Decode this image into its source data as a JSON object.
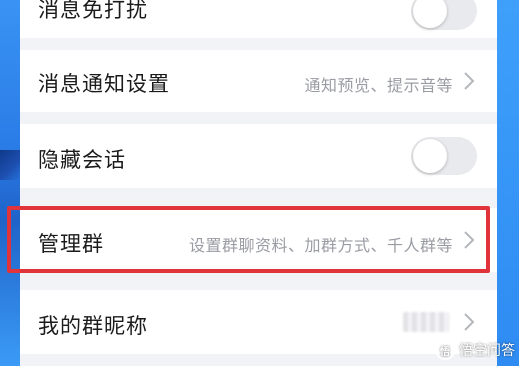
{
  "settings": {
    "rows": [
      {
        "label": "消息免打扰",
        "type": "toggle",
        "value": "",
        "enabled": false
      },
      {
        "label": "消息通知设置",
        "type": "link",
        "value": "通知预览、提示音等"
      },
      {
        "label": "隐藏会话",
        "type": "toggle",
        "value": "",
        "enabled": false
      },
      {
        "label": "管理群",
        "type": "link",
        "value": "设置群聊资料、加群方式、千人群等"
      },
      {
        "label": "我的群昵称",
        "type": "link",
        "value": ""
      }
    ]
  },
  "annotation": {
    "highlight_color": "#e0343a",
    "highlighted_row": "管理群"
  },
  "watermark": {
    "text": "悟空问答",
    "icon": "wukong-logo-icon"
  },
  "colors": {
    "toggle_off": "#e9eaed",
    "secondary_text": "#9a9ca3",
    "background_blue": "#2f8bf0"
  }
}
